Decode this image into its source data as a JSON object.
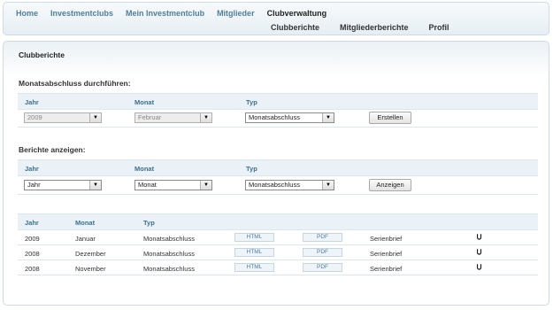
{
  "nav": {
    "primary": [
      "Home",
      "Investmentclubs",
      "Mein Investmentclub",
      "Mitglieder",
      "Clubverwaltung"
    ],
    "secondary": [
      "Clubberichte",
      "Mitgliederberichte",
      "Profil"
    ]
  },
  "panel": {
    "title": "Clubberichte"
  },
  "create": {
    "section_title": "Monatsabschluss durchführen:",
    "headers": {
      "jahr": "Jahr",
      "monat": "Monat",
      "typ": "Typ"
    },
    "jahr_value": "2009",
    "monat_value": "Februar",
    "typ_value": "Monatsabschluss",
    "button": "Erstellen"
  },
  "show": {
    "section_title": "Berichte anzeigen:",
    "headers": {
      "jahr": "Jahr",
      "monat": "Monat",
      "typ": "Typ"
    },
    "jahr_value": "Jahr",
    "monat_value": "Monat",
    "typ_value": "Monatsabschluss",
    "button": "Anzeigen"
  },
  "table": {
    "headers": {
      "jahr": "Jahr",
      "monat": "Monat",
      "typ": "Typ"
    },
    "rows": [
      {
        "jahr": "2009",
        "monat": "Januar",
        "typ": "Monatsabschluss",
        "html": "HTML",
        "pdf": "PDF",
        "serienbrief": "Serienbrief",
        "action_icon": "curved-arrow-icon"
      },
      {
        "jahr": "2008",
        "monat": "Dezember",
        "typ": "Monatsabschluss",
        "html": "HTML",
        "pdf": "PDF",
        "serienbrief": "Serienbrief",
        "action_icon": "curved-arrow-icon"
      },
      {
        "jahr": "2008",
        "monat": "November",
        "typ": "Monatsabschluss",
        "html": "HTML",
        "pdf": "PDF",
        "serienbrief": "Serienbrief",
        "action_icon": "curved-arrow-icon"
      }
    ]
  },
  "colors": {
    "link": "#4f7f9e",
    "header_bar": "#eaf2f7",
    "border": "#cfdbe3"
  }
}
